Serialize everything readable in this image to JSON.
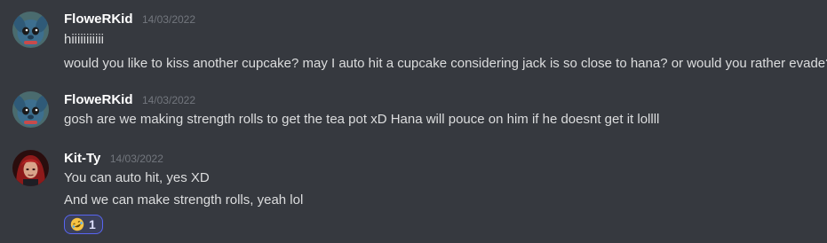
{
  "messages": [
    {
      "author": "FloweRKid",
      "timestamp": "14/03/2022",
      "avatar_icon": "stitch-avatar",
      "lines": [
        "hiiiiiiiiiii",
        "would you like to kiss another cupcake? may I auto hit a cupcake considering jack is so close to hana? or would you rather evade? 😊"
      ]
    },
    {
      "author": "FloweRKid",
      "timestamp": "14/03/2022",
      "avatar_icon": "stitch-avatar",
      "lines": [
        "gosh are we making strength rolls to get the tea pot xD Hana will pouce on him if he doesnt get it lollll"
      ]
    },
    {
      "author": "Kit-Ty",
      "timestamp": "14/03/2022",
      "avatar_icon": "red-hair-character-avatar",
      "lines": [
        "You can auto hit, yes XD",
        "And we can make strength rolls, yeah lol"
      ],
      "reaction": {
        "emoji": "rolling-on-floor-laughing",
        "count": "1"
      }
    }
  ],
  "colors": {
    "background": "#36393f",
    "username": "#ffffff",
    "text": "#dcddde",
    "timestamp": "#72767d",
    "reaction_bg": "#3b405a",
    "reaction_border": "#5865f2"
  }
}
